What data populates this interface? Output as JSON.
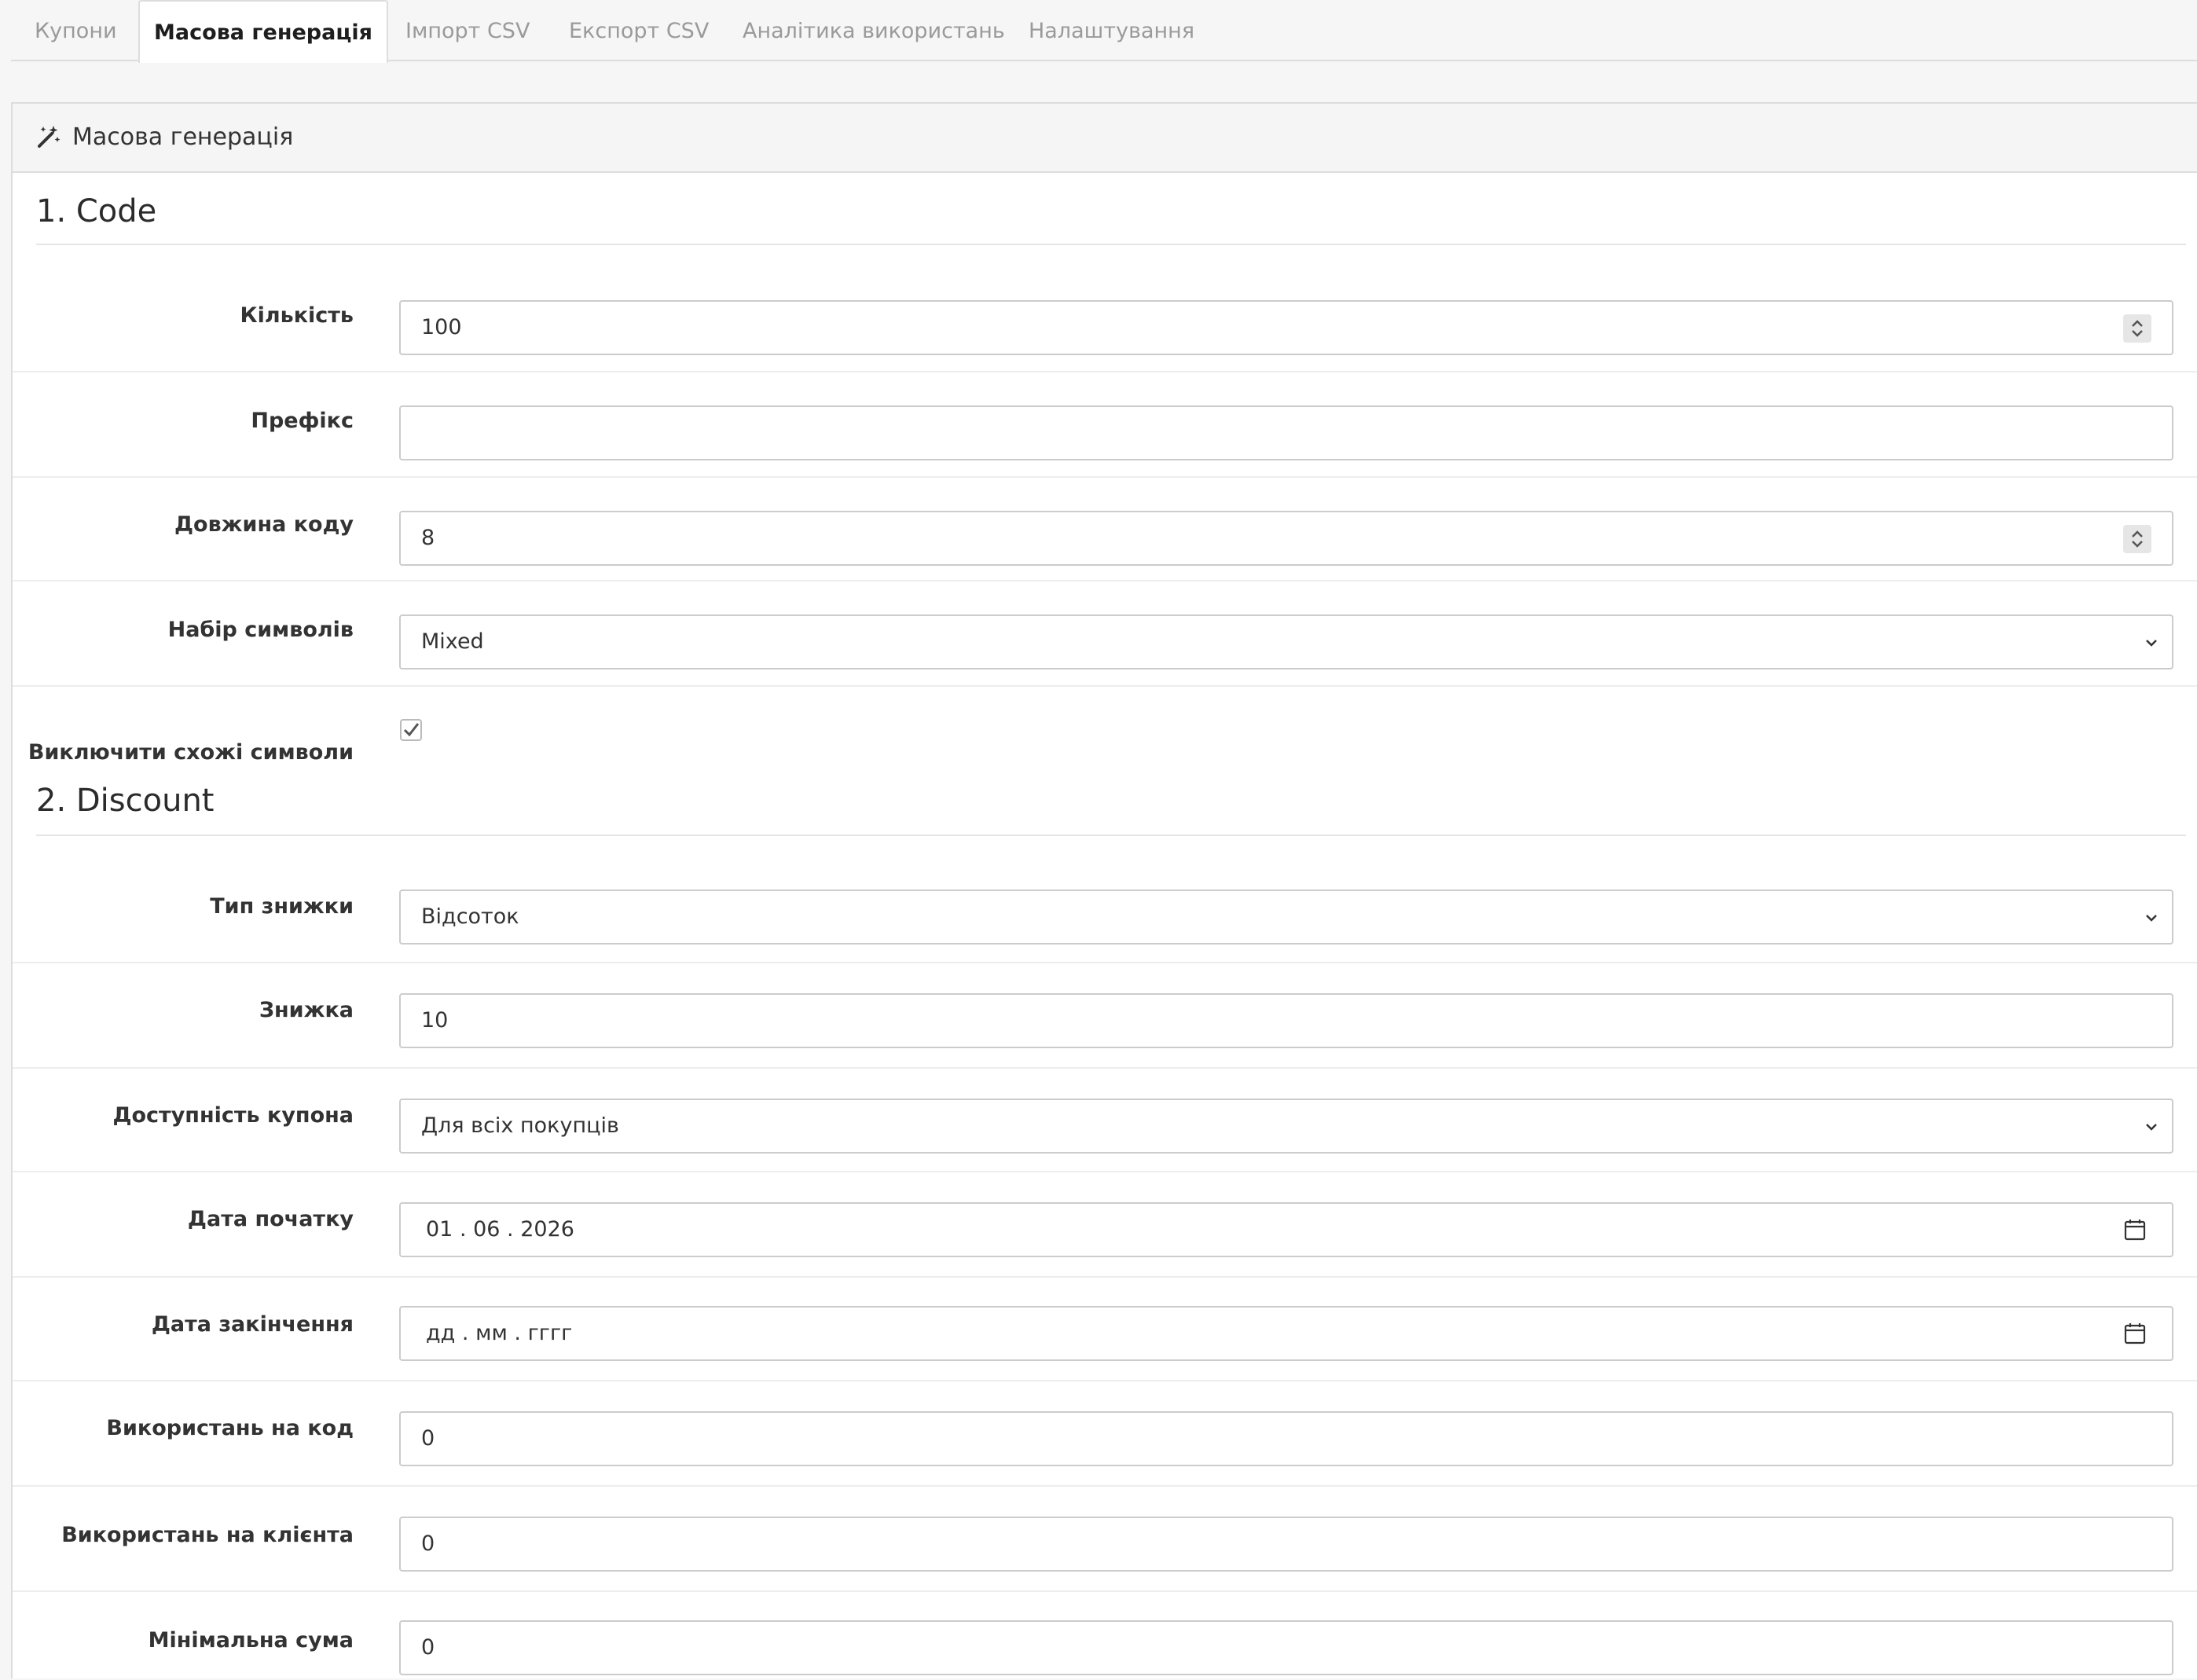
{
  "tabs": [
    {
      "label": "Купони"
    },
    {
      "label": "Масова генерація"
    },
    {
      "label": "Імпорт CSV"
    },
    {
      "label": "Експорт CSV"
    },
    {
      "label": "Аналітика використань"
    },
    {
      "label": "Налаштування"
    }
  ],
  "panel": {
    "title": "Масова генерація",
    "icon": "magic-wand-icon"
  },
  "sections": {
    "code": "1. Code",
    "discount": "2. Discount"
  },
  "fields": {
    "quantity": {
      "label": "Кількість",
      "value": "100"
    },
    "prefix": {
      "label": "Префікс",
      "value": ""
    },
    "code_length": {
      "label": "Довжина коду",
      "value": "8"
    },
    "charset": {
      "label": "Набір символів",
      "value": "Mixed"
    },
    "exclude_similar": {
      "label": "Виключити схожі символи",
      "checked": true
    },
    "discount_type": {
      "label": "Тип знижки",
      "value": "Відсоток"
    },
    "discount": {
      "label": "Знижка",
      "value": "10"
    },
    "availability": {
      "label": "Доступність купона",
      "value": "Для всіх покупців"
    },
    "start_date": {
      "label": "Дата початку",
      "value": "01 . 06 . 2026"
    },
    "end_date": {
      "label": "Дата закінчення",
      "placeholder": "дд . мм . гггг"
    },
    "uses_per_code": {
      "label": "Використань на код",
      "value": "0"
    },
    "uses_per_customer": {
      "label": "Використань на клієнта",
      "value": "0"
    },
    "min_sum": {
      "label": "Мінімальна сума",
      "value": "0"
    }
  },
  "colors": {
    "border": "#cccccc",
    "heading_bg": "#f5f5f5",
    "page_bg": "#f6f6f6"
  }
}
